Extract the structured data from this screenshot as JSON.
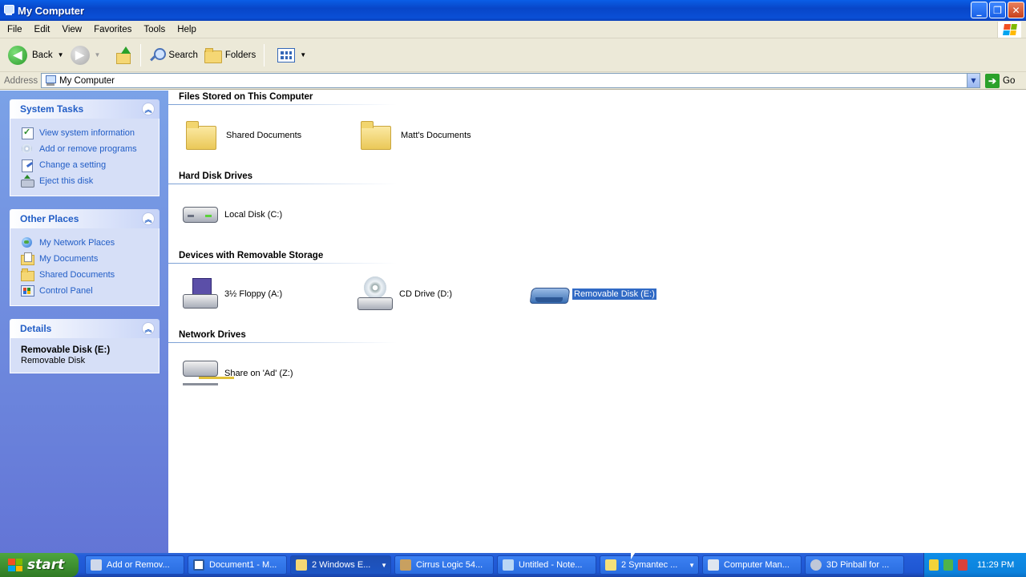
{
  "window": {
    "title": "My Computer"
  },
  "menu": [
    "File",
    "Edit",
    "View",
    "Favorites",
    "Tools",
    "Help"
  ],
  "toolbar": {
    "back_label": "Back",
    "search_label": "Search",
    "folders_label": "Folders"
  },
  "address": {
    "label": "Address",
    "value": "My Computer",
    "go_label": "Go"
  },
  "sidebar": {
    "system_tasks": {
      "title": "System Tasks",
      "items": [
        {
          "label": "View system information",
          "icon": "system-info-icon"
        },
        {
          "label": "Add or remove programs",
          "icon": "add-remove-programs-icon"
        },
        {
          "label": "Change a setting",
          "icon": "change-setting-icon"
        },
        {
          "label": "Eject this disk",
          "icon": "eject-icon"
        }
      ]
    },
    "other_places": {
      "title": "Other Places",
      "items": [
        {
          "label": "My Network Places",
          "icon": "network-places-icon"
        },
        {
          "label": "My Documents",
          "icon": "my-documents-icon"
        },
        {
          "label": "Shared Documents",
          "icon": "shared-documents-icon"
        },
        {
          "label": "Control Panel",
          "icon": "control-panel-icon"
        }
      ]
    },
    "details": {
      "title": "Details",
      "name": "Removable Disk (E:)",
      "type": "Removable Disk"
    }
  },
  "groups": {
    "files": {
      "title": "Files Stored on This Computer",
      "items": [
        "Shared Documents",
        "Matt's Documents"
      ]
    },
    "hard_disks": {
      "title": "Hard Disk Drives",
      "items": [
        "Local Disk (C:)"
      ]
    },
    "removable": {
      "title": "Devices with Removable Storage",
      "items": [
        "3½ Floppy (A:)",
        "CD Drive (D:)",
        "Removable Disk (E:)"
      ],
      "selected": "Removable Disk (E:)"
    },
    "network": {
      "title": "Network Drives",
      "items": [
        "Share on 'Ad' (Z:)"
      ]
    }
  },
  "taskbar": {
    "start_label": "start",
    "tasks": [
      "Add or Remov...",
      "Document1 - M...",
      "2 Windows E...",
      "Cirrus Logic 54...",
      "Untitled - Note...",
      "2 Symantec ...",
      "Computer Man...",
      "3D Pinball for ..."
    ],
    "clock": "11:29 PM"
  },
  "colors": {
    "title_bar": "#0a5ee6",
    "sidebar": "#7ba2e7",
    "selection": "#316ac5",
    "start_button": "#3c8d2f"
  }
}
